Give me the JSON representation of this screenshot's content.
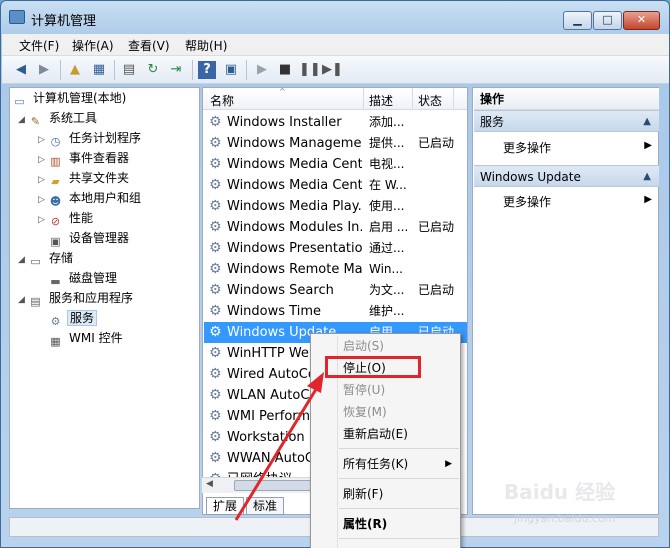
{
  "window": {
    "title": "计算机管理",
    "btn_min": "▁",
    "btn_max": "□",
    "btn_close": "✕"
  },
  "menubar": [
    "文件(F)",
    "操作(A)",
    "查看(V)",
    "帮助(H)"
  ],
  "tree": {
    "root": "计算机管理(本地)",
    "system_tools": "系统工具",
    "task_scheduler": "任务计划程序",
    "event_viewer": "事件查看器",
    "shared_folders": "共享文件夹",
    "local_users": "本地用户和组",
    "performance": "性能",
    "device_manager": "设备管理器",
    "storage": "存储",
    "disk_mgmt": "磁盘管理",
    "services_apps": "服务和应用程序",
    "services": "服务",
    "wmi": "WMI 控件"
  },
  "list": {
    "col_name": "名称",
    "col_desc": "描述",
    "col_status": "状态",
    "rows": [
      {
        "name": "Windows Installer",
        "desc": "添加...",
        "status": ""
      },
      {
        "name": "Windows Manageme...",
        "desc": "提供...",
        "status": "已启动"
      },
      {
        "name": "Windows Media Cent...",
        "desc": "电视...",
        "status": ""
      },
      {
        "name": "Windows Media Cent...",
        "desc": "在 W...",
        "status": ""
      },
      {
        "name": "Windows Media Play...",
        "desc": "使用...",
        "status": ""
      },
      {
        "name": "Windows Modules In...",
        "desc": "启用 ...",
        "status": "已启动"
      },
      {
        "name": "Windows Presentatio...",
        "desc": "通过...",
        "status": ""
      },
      {
        "name": "Windows Remote Ma...",
        "desc": "Win...",
        "status": ""
      },
      {
        "name": "Windows Search",
        "desc": "为文...",
        "status": "已启动"
      },
      {
        "name": "Windows Time",
        "desc": "维护...",
        "status": ""
      },
      {
        "name": "Windows Update",
        "desc": "启用 ...",
        "status": "已启动"
      },
      {
        "name": "WinHTTP Web",
        "desc": "",
        "status": ""
      },
      {
        "name": "Wired AutoCo",
        "desc": "",
        "status": ""
      },
      {
        "name": "WLAN AutoCo",
        "desc": "",
        "status": ""
      },
      {
        "name": "WMI Perform",
        "desc": "",
        "status": ""
      },
      {
        "name": "Workstation",
        "desc": "",
        "status": ""
      },
      {
        "name": "WWAN AutoCo",
        "desc": "",
        "status": ""
      },
      {
        "name": "已网络协议",
        "desc": "",
        "status": ""
      }
    ]
  },
  "tabs": [
    "扩展",
    "标准"
  ],
  "actions": {
    "title": "操作",
    "group1": "服务",
    "more1": "更多操作",
    "group2": "Windows Update",
    "more2": "更多操作"
  },
  "context_menu": {
    "start": "启动(S)",
    "stop": "停止(O)",
    "pause": "暂停(U)",
    "resume": "恢复(M)",
    "restart": "重新启动(E)",
    "all_tasks": "所有任务(K)",
    "refresh": "刷新(F)",
    "properties": "属性(R)"
  },
  "watermark": {
    "brand": "Baidu 经验",
    "sub": "jingyan.baidu.com"
  },
  "colors": {
    "selection": "#3399ff",
    "highlight": "#e0262a"
  }
}
